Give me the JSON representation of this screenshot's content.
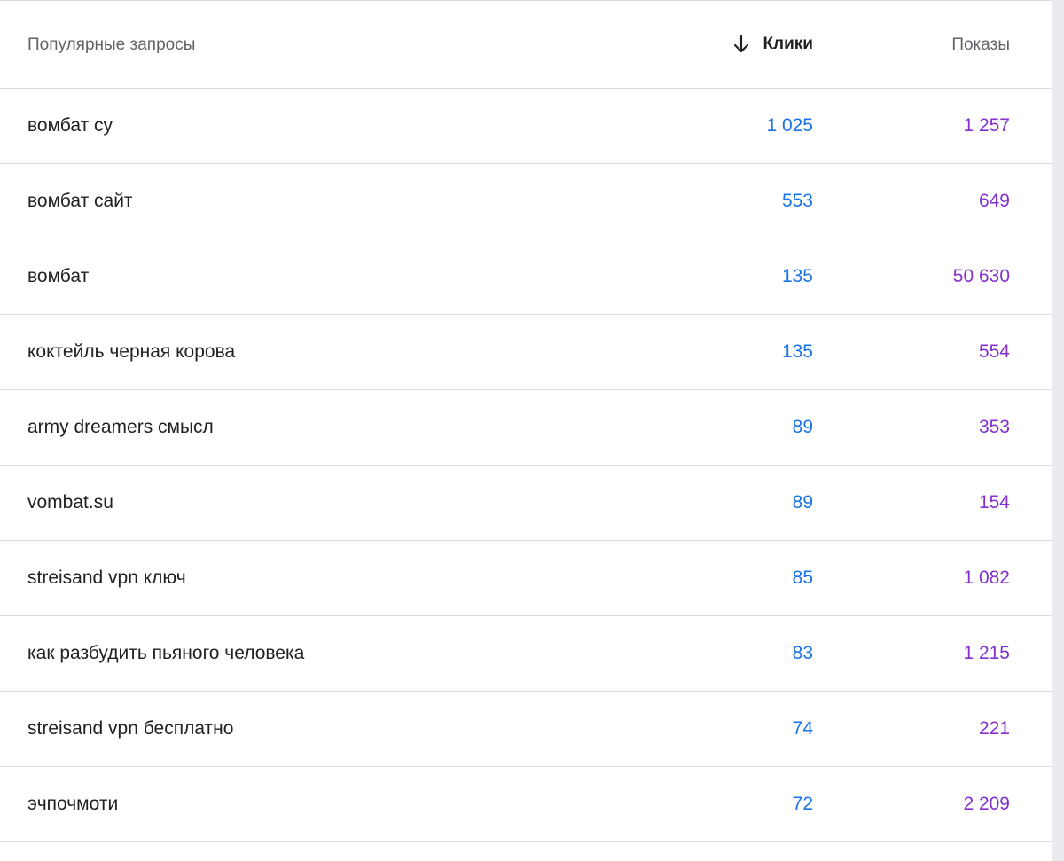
{
  "colors": {
    "clicks": "#1a73e8",
    "impressions": "#8430ce",
    "text": "#202124",
    "header_text": "#5f6368",
    "divider": "#dadce0"
  },
  "table": {
    "headers": {
      "query": "Популярные запросы",
      "clicks": "Клики",
      "impressions": "Показы",
      "sort_icon": "arrow-down-icon"
    },
    "rows": [
      {
        "query": "вомбат су",
        "clicks": "1 025",
        "impressions": "1 257"
      },
      {
        "query": "вомбат сайт",
        "clicks": "553",
        "impressions": "649"
      },
      {
        "query": "вомбат",
        "clicks": "135",
        "impressions": "50 630"
      },
      {
        "query": "коктейль черная корова",
        "clicks": "135",
        "impressions": "554"
      },
      {
        "query": "army dreamers смысл",
        "clicks": "89",
        "impressions": "353"
      },
      {
        "query": "vombat.su",
        "clicks": "89",
        "impressions": "154"
      },
      {
        "query": "streisand vpn ключ",
        "clicks": "85",
        "impressions": "1 082"
      },
      {
        "query": "как разбудить пьяного человека",
        "clicks": "83",
        "impressions": "1 215"
      },
      {
        "query": "streisand vpn бесплатно",
        "clicks": "74",
        "impressions": "221"
      },
      {
        "query": "эчпочмоти",
        "clicks": "72",
        "impressions": "2 209"
      }
    ]
  }
}
